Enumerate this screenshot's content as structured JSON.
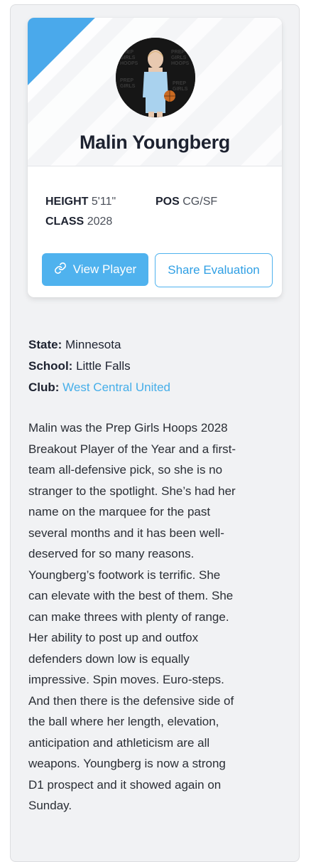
{
  "player": {
    "name": "Malin Youngberg",
    "photo": "player-photo",
    "height_label": "HEIGHT",
    "height_value": "5'11\"",
    "pos_label": "POS",
    "pos_value": "CG/SF",
    "class_label": "CLASS",
    "class_value": "2028"
  },
  "actions": {
    "view_label": "View Player",
    "share_label": "Share Evaluation"
  },
  "details": {
    "state_label": "State:",
    "state_value": "Minnesota",
    "school_label": "School:",
    "school_value": "Little Falls",
    "club_label": "Club:",
    "club_value": "West Central United"
  },
  "bio_lines": [
    "Malin was the Prep Girls Hoops 2028",
    "Breakout Player of the Year and a first-",
    "team all-defensive pick, so she is no",
    "stranger to the spotlight. She’s had her",
    "name on the marquee for the past",
    "several months and it has been well-",
    "deserved for so many reasons.",
    "Youngberg’s footwork is terrific. She",
    "can elevate with the best of them. She",
    "can make threes with plenty of range.",
    "Her ability to post up and outfox",
    "defenders down low is equally",
    "impressive. Spin moves. Euro-steps.",
    "And then there is the defensive side of",
    "the ball where her length, elevation,",
    "anticipation and athleticism are all",
    "weapons. Youngberg is now a strong",
    "D1 prospect and it showed again on",
    "Sunday."
  ],
  "colors": {
    "accent": "#4fb2ee",
    "link": "#45aee9",
    "text": "#1d2230"
  },
  "icons": {
    "view_button_icon": "link-icon"
  }
}
